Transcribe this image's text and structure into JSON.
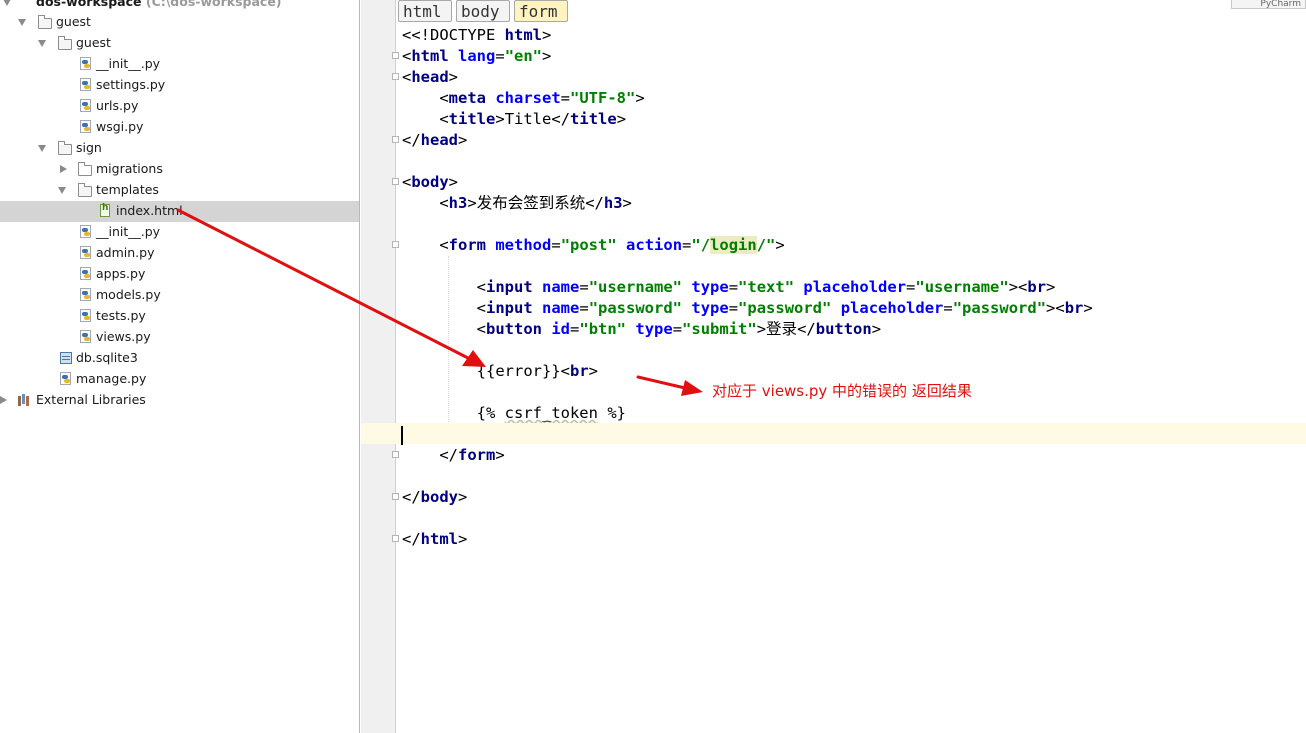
{
  "project_tree": {
    "root": {
      "label": "dos-workspace",
      "path": "(C:\\dos-workspace)"
    },
    "items": [
      {
        "label": "guest"
      },
      {
        "label": "guest"
      },
      {
        "label": "__init__.py"
      },
      {
        "label": "settings.py"
      },
      {
        "label": "urls.py"
      },
      {
        "label": "wsgi.py"
      },
      {
        "label": "sign"
      },
      {
        "label": "migrations"
      },
      {
        "label": "templates"
      },
      {
        "label": "index.html"
      },
      {
        "label": "__init__.py"
      },
      {
        "label": "admin.py"
      },
      {
        "label": "apps.py"
      },
      {
        "label": "models.py"
      },
      {
        "label": "tests.py"
      },
      {
        "label": "views.py"
      },
      {
        "label": "db.sqlite3"
      },
      {
        "label": "manage.py"
      },
      {
        "label": "External Libraries"
      }
    ]
  },
  "editor": {
    "breadcrumbs": [
      "html",
      "body",
      "form"
    ],
    "top_right_label": "PyCharm",
    "code": {
      "doctype": "<!DOCTYPE ",
      "html": "html",
      "lang_attr": "lang",
      "lang_val": "\"en\"",
      "head": "head",
      "meta": "meta",
      "charset_attr": "charset",
      "charset_val": "\"UTF-8\"",
      "title_tag": "title",
      "title_text": "Title",
      "body": "body",
      "h3": "h3",
      "h3_text": "发布会签到系统",
      "form": "form",
      "method_attr": "method",
      "method_val": "\"post\"",
      "action_attr": "action",
      "action_val_pre": "\"/",
      "action_val_hl": "login",
      "action_val_post": "/\"",
      "input": "input",
      "name_attr": "name",
      "username_val": "\"username\"",
      "type_attr": "type",
      "text_val": "\"text\"",
      "placeholder_attr": "placeholder",
      "password_val": "\"password\"",
      "br": "br",
      "button": "button",
      "id_attr": "id",
      "btn_val": "\"btn\"",
      "submit_val": "\"submit\"",
      "button_text": "登录",
      "error_expr": "{{error}}",
      "csrf_pre": "{% ",
      "csrf_token": "csrf_token",
      "csrf_post": " %}"
    }
  },
  "annotation": {
    "text": "对应于 views.py 中的错误的 返回结果",
    "color": "#e11010"
  }
}
